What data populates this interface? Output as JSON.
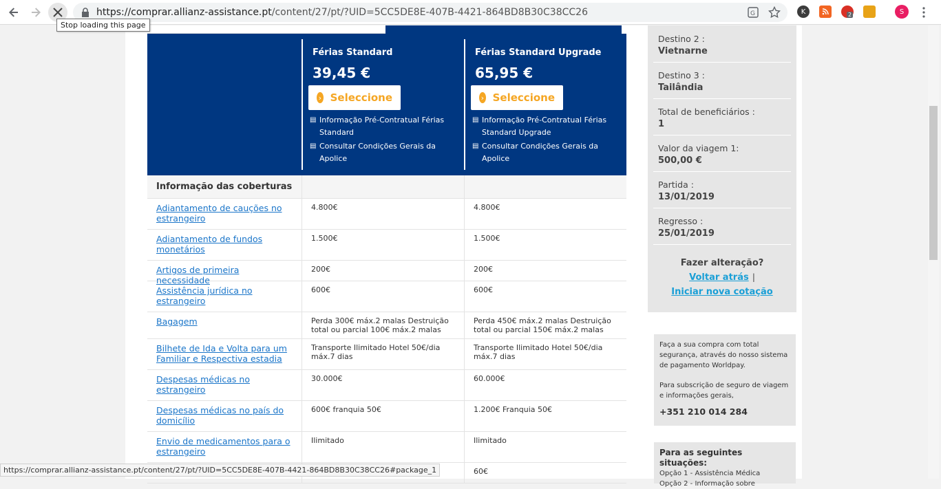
{
  "browser": {
    "url_host": "https://comprar.allianz-assistance.pt",
    "url_path": "/content/27/pt/?UID=5CC5DE8E-407B-4421-864BD8B30C38CC26",
    "tooltip": "Stop loading this page",
    "status_url": "https://comprar.allianz-assistance.pt/content/27/pt/?UID=5CC5DE8E-407B-4421-864BD8B30C38CC26#package_1",
    "ext_badge": "2",
    "profile_initial": "S",
    "ext_k": "K"
  },
  "packages": [
    {
      "name": "Férias Standard",
      "price": "39,45 €",
      "button": "Seleccione",
      "doc1": "Informação Pré-Contratual Férias Standard",
      "doc2": "Consultar Condições Gerais da Apolice"
    },
    {
      "name": "Férias Standard Upgrade",
      "price": "65,95 €",
      "button": "Seleccione",
      "doc1": "Informação Pré-Contratual Férias Standard Upgrade",
      "doc2": "Consultar Condições Gerais da Apolice"
    }
  ],
  "table": {
    "header": "Informação das coberturas",
    "rows": [
      {
        "label": "Adiantamento de cauções no estrangeiro",
        "v1": "4.800€",
        "v2": "4.800€"
      },
      {
        "label": "Adiantamento de fundos monetários",
        "v1": "1.500€",
        "v2": "1.500€"
      },
      {
        "label": "Artigos de primeira necessidade",
        "v1": "200€",
        "v2": "200€"
      },
      {
        "label": "Assistência jurídica no estrangeiro",
        "v1": "600€",
        "v2": "600€"
      },
      {
        "label": "Bagagem",
        "v1": "Perda 300€ máx.2 malas Destruição total ou parcial 100€ máx.2 malas",
        "v2": "Perda 450€ máx.2 malas Destruição total ou parcial 150€ máx.2 malas"
      },
      {
        "label": "Bilhete de Ida e Volta para um Familiar e Respectiva estadia",
        "v1": "Transporte Ilimitado Hotel 50€/dia máx.7 dias",
        "v2": "Transporte Ilimitado Hotel 50€/dia máx.7 dias"
      },
      {
        "label": "Despesas médicas no estrangeiro",
        "v1": "30.000€",
        "v2": "60.000€"
      },
      {
        "label": "Despesas médicas no país do domicílio",
        "v1": "600€ franquia 50€",
        "v2": "1.200€ Franquia 50€"
      },
      {
        "label": "Envio de medicamentos para o estrangeiro",
        "v1": "Ilimitado",
        "v2": "Ilimitado"
      },
      {
        "label": "",
        "v1": "",
        "v2": "60€"
      }
    ]
  },
  "sidebar": {
    "items": [
      {
        "label": "Destino 2 :",
        "value": "Vietnarne"
      },
      {
        "label": "Destino 3 :",
        "value": "Tailândia"
      },
      {
        "label": "Total de beneficiários :",
        "value": "1"
      },
      {
        "label": "Valor da viagem 1:",
        "value": "500,00 €"
      },
      {
        "label": "Partida :",
        "value": "13/01/2019"
      },
      {
        "label": "Regresso :",
        "value": "25/01/2019"
      }
    ],
    "change_title": "Fazer alteração?",
    "back_link": "Voltar atrás",
    "separator": "|",
    "new_quote_link": "Iniciar nova cotação",
    "payment_text": "Faça a sua compra com total segurança, através do nosso sistema de pagamento Worldpay.",
    "subscription_text": "Para subscrição de seguro de viagem e informações gerais,",
    "phone": "+351 210 014 284",
    "situations_title": "Para as seguintes situações:",
    "option1": "Opção 1 - Assistência Médica",
    "option2": "Opção 2 - Informação sobre"
  }
}
